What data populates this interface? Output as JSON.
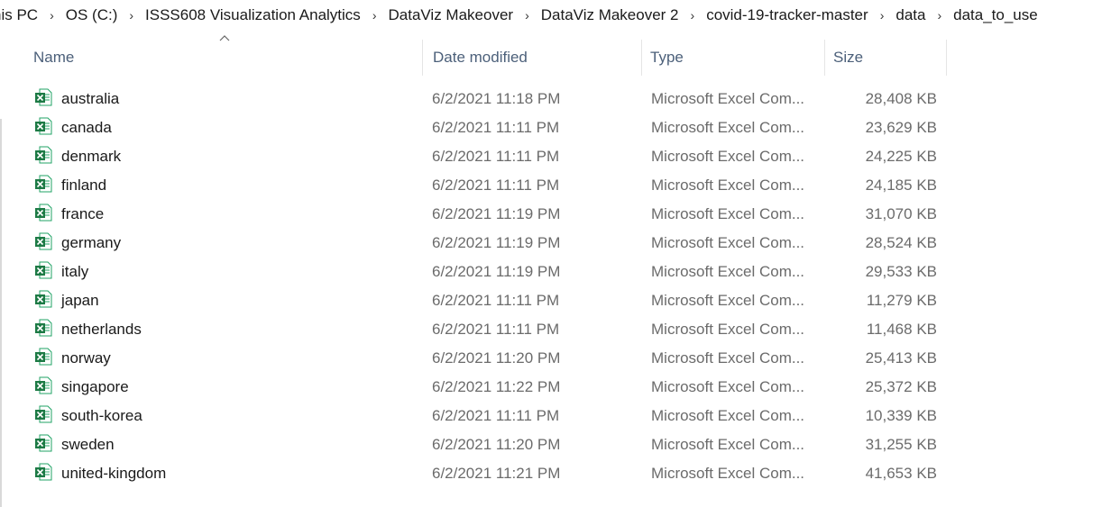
{
  "breadcrumb": [
    "his PC",
    "OS (C:)",
    "ISSS608 Visualization Analytics",
    "DataViz Makeover",
    "DataViz Makeover 2",
    "covid-19-tracker-master",
    "data",
    "data_to_use"
  ],
  "columns": {
    "name": "Name",
    "date": "Date modified",
    "type": "Type",
    "size": "Size"
  },
  "files": [
    {
      "name": "australia",
      "date": "6/2/2021 11:18 PM",
      "type": "Microsoft Excel Com...",
      "size": "28,408 KB"
    },
    {
      "name": "canada",
      "date": "6/2/2021 11:11 PM",
      "type": "Microsoft Excel Com...",
      "size": "23,629 KB"
    },
    {
      "name": "denmark",
      "date": "6/2/2021 11:11 PM",
      "type": "Microsoft Excel Com...",
      "size": "24,225 KB"
    },
    {
      "name": "finland",
      "date": "6/2/2021 11:11 PM",
      "type": "Microsoft Excel Com...",
      "size": "24,185 KB"
    },
    {
      "name": "france",
      "date": "6/2/2021 11:19 PM",
      "type": "Microsoft Excel Com...",
      "size": "31,070 KB"
    },
    {
      "name": "germany",
      "date": "6/2/2021 11:19 PM",
      "type": "Microsoft Excel Com...",
      "size": "28,524 KB"
    },
    {
      "name": "italy",
      "date": "6/2/2021 11:19 PM",
      "type": "Microsoft Excel Com...",
      "size": "29,533 KB"
    },
    {
      "name": "japan",
      "date": "6/2/2021 11:11 PM",
      "type": "Microsoft Excel Com...",
      "size": "11,279 KB"
    },
    {
      "name": "netherlands",
      "date": "6/2/2021 11:11 PM",
      "type": "Microsoft Excel Com...",
      "size": "11,468 KB"
    },
    {
      "name": "norway",
      "date": "6/2/2021 11:20 PM",
      "type": "Microsoft Excel Com...",
      "size": "25,413 KB"
    },
    {
      "name": "singapore",
      "date": "6/2/2021 11:22 PM",
      "type": "Microsoft Excel Com...",
      "size": "25,372 KB"
    },
    {
      "name": "south-korea",
      "date": "6/2/2021 11:11 PM",
      "type": "Microsoft Excel Com...",
      "size": "10,339 KB"
    },
    {
      "name": "sweden",
      "date": "6/2/2021 11:20 PM",
      "type": "Microsoft Excel Com...",
      "size": "31,255 KB"
    },
    {
      "name": "united-kingdom",
      "date": "6/2/2021 11:21 PM",
      "type": "Microsoft Excel Com...",
      "size": "41,653 KB"
    }
  ],
  "icons": {
    "file": "excel-file-icon",
    "sort": "sort-ascending-icon",
    "separator": "chevron-right-icon"
  },
  "colors": {
    "excel_green": "#1d7a45",
    "header_text": "#4c607a",
    "meta_text": "#6b6b6b"
  }
}
